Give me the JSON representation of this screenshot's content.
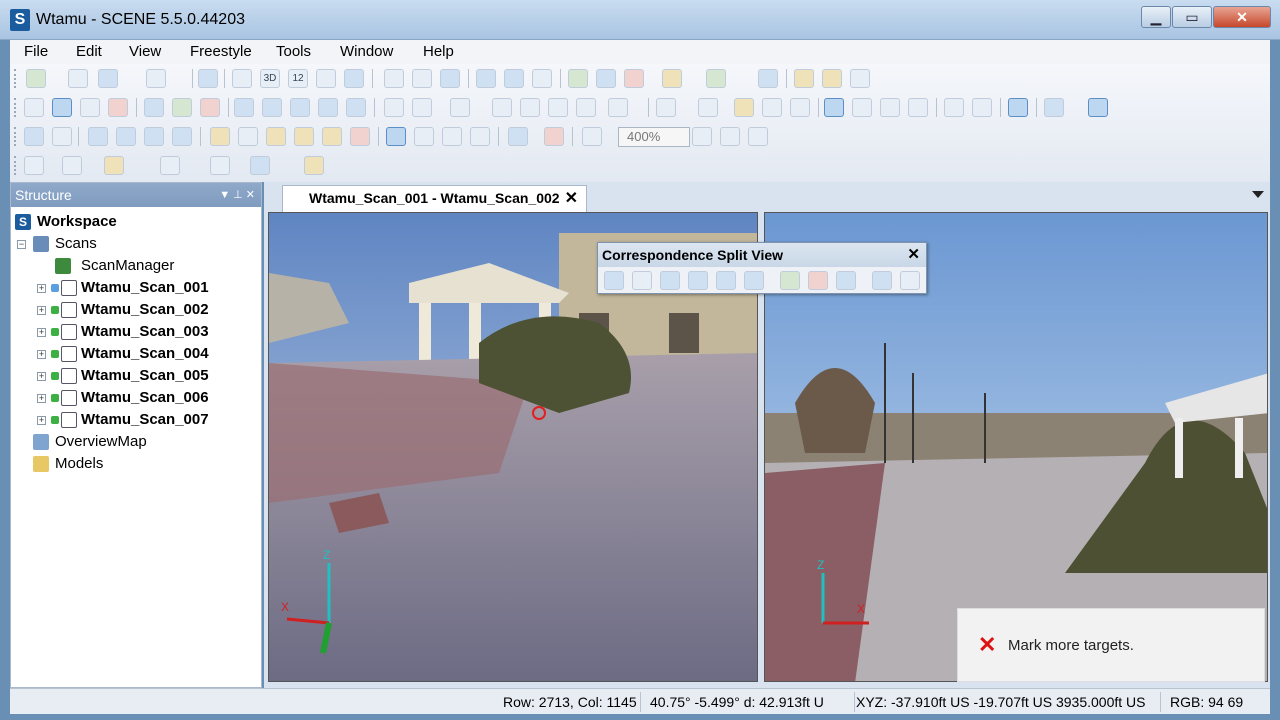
{
  "window": {
    "title": "Wtamu - SCENE 5.5.0.44203",
    "app_icon_letter": "S",
    "minimize": "▁",
    "maximize": "▭",
    "close": "✕"
  },
  "menu": [
    "File",
    "Edit",
    "View",
    "Freestyle",
    "Tools",
    "Window",
    "Help"
  ],
  "toolbar": {
    "zoom_value": "400%",
    "icon_3d": "3D",
    "icon_12": "12"
  },
  "structure": {
    "title": "Structure",
    "pin": "▼  ⊥  ✕",
    "workspace": "Workspace",
    "scans": "Scans",
    "scan_manager": "ScanManager",
    "scan_items": [
      "Wtamu_Scan_001",
      "Wtamu_Scan_002",
      "Wtamu_Scan_003",
      "Wtamu_Scan_004",
      "Wtamu_Scan_005",
      "Wtamu_Scan_006",
      "Wtamu_Scan_007"
    ],
    "overview_map": "OverviewMap",
    "models": "Models"
  },
  "document": {
    "tab_title": "Wtamu_Scan_001 - Wtamu_Scan_002",
    "tab_close": "✕"
  },
  "correspondence": {
    "title": "Correspondence Split View",
    "close": "✕"
  },
  "views": {
    "axis_left": {
      "x": "X",
      "z": "Z"
    },
    "axis_right": {
      "x": "X",
      "z": "Z"
    }
  },
  "toast": {
    "icon": "✕",
    "message": "Mark more targets."
  },
  "status": {
    "row_col": "Row: 2713, Col: 1145",
    "angles": "40.75° -5.499°  d: 42.913ft U",
    "xyz": "XYZ: -37.910ft US -19.707ft US 3935.000ft US",
    "rgb": "RGB: 94 69"
  },
  "colors": {
    "accent": "#1b5c9e",
    "error": "#dd1111",
    "panel_header": "#8ea9c9"
  }
}
